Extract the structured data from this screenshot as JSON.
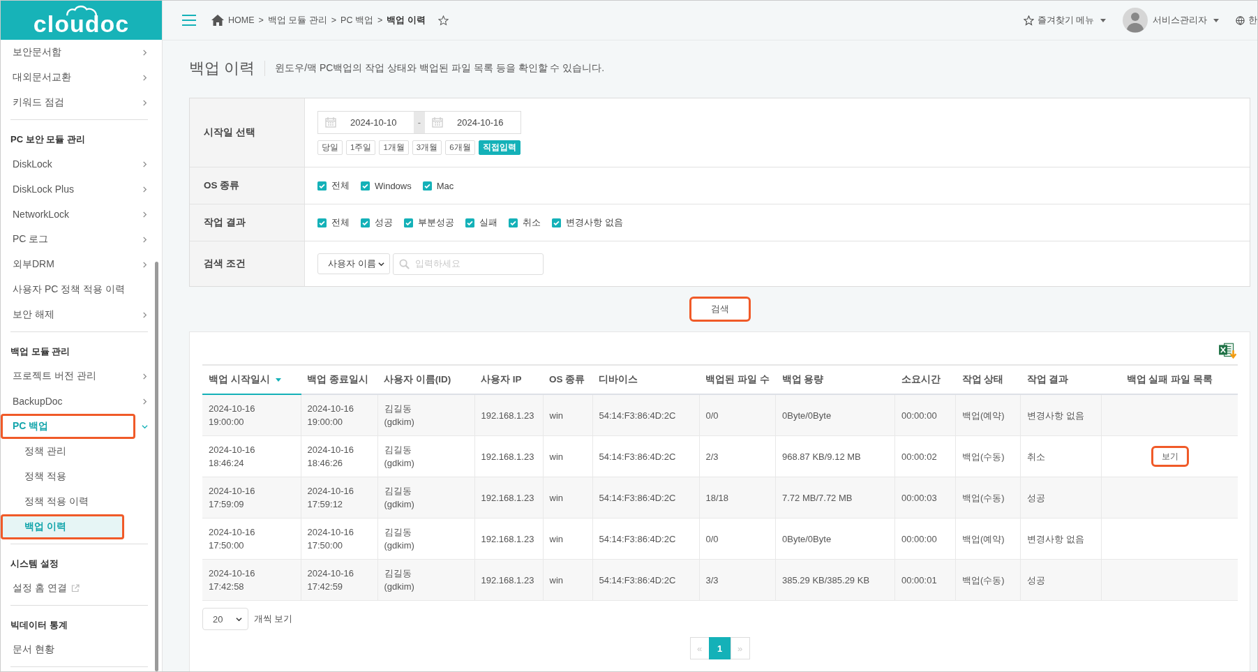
{
  "logo": {
    "text": "cloudoc"
  },
  "header": {
    "breadcrumb": [
      {
        "label": "HOME",
        "current": false
      },
      {
        "label": "백업 모듈 관리",
        "current": false
      },
      {
        "label": "PC 백업",
        "current": false
      },
      {
        "label": "백업 이력",
        "current": true
      }
    ],
    "separator": ">",
    "favorite_menu": "즐겨찾기 메뉴",
    "user_name": "서비스관리자",
    "language": "한"
  },
  "sidebar": {
    "sections": [
      {
        "items": [
          {
            "label": "보안문서함",
            "kind": "group",
            "expanded": false,
            "selected": false,
            "highlighted": false
          },
          {
            "label": "대외문서교환",
            "kind": "group",
            "expanded": false,
            "selected": false,
            "highlighted": false
          },
          {
            "label": "키워드 점검",
            "kind": "group",
            "expanded": false,
            "selected": false,
            "highlighted": false
          }
        ]
      },
      {
        "heading": "PC 보안 모듈 관리",
        "items": [
          {
            "label": "DiskLock",
            "kind": "group",
            "expanded": false,
            "selected": false,
            "highlighted": false
          },
          {
            "label": "DiskLock Plus",
            "kind": "group",
            "expanded": false,
            "selected": false,
            "highlighted": false
          },
          {
            "label": "NetworkLock",
            "kind": "group",
            "expanded": false,
            "selected": false,
            "highlighted": false
          },
          {
            "label": "PC 로그",
            "kind": "group",
            "expanded": false,
            "selected": false,
            "highlighted": false
          },
          {
            "label": "외부DRM",
            "kind": "group",
            "expanded": false,
            "selected": false,
            "highlighted": false
          },
          {
            "label": "사용자 PC 정책 적용 이력",
            "kind": "link",
            "selected": false,
            "highlighted": false
          },
          {
            "label": "보안 해제",
            "kind": "group",
            "expanded": false,
            "selected": false,
            "highlighted": false
          }
        ]
      },
      {
        "heading": "백업 모듈 관리",
        "items": [
          {
            "label": "프로젝트 버전 관리",
            "kind": "group",
            "expanded": false,
            "selected": false,
            "highlighted": false
          },
          {
            "label": "BackupDoc",
            "kind": "group",
            "expanded": false,
            "selected": false,
            "highlighted": false
          },
          {
            "label": "PC 백업",
            "kind": "group",
            "expanded": true,
            "selected": false,
            "highlighted": true,
            "children": [
              {
                "label": "정책 관리",
                "selected": false,
                "highlighted": false
              },
              {
                "label": "정책 적용",
                "selected": false,
                "highlighted": false
              },
              {
                "label": "정책 적용 이력",
                "selected": false,
                "highlighted": false
              },
              {
                "label": "백업 이력",
                "selected": true,
                "highlighted": true
              }
            ]
          }
        ]
      },
      {
        "heading": "시스템 설정",
        "items": [
          {
            "label": "설정 홈 연결",
            "kind": "external",
            "selected": false,
            "highlighted": false
          }
        ]
      },
      {
        "heading": "빅데이터 통계",
        "items": [
          {
            "label": "문서 현황",
            "kind": "link",
            "selected": false,
            "highlighted": false
          }
        ]
      }
    ]
  },
  "page": {
    "title": "백업 이력",
    "description": "윈도우/맥 PC백업의 작업 상태와 백업된 파일 목록 등을 확인할 수 있습니다."
  },
  "filters": [
    {
      "kind": "date",
      "label": "시작일 선택",
      "start": "2024-10-10",
      "separator": "-",
      "end": "2024-10-16",
      "ranges": [
        {
          "label": "당일",
          "selected": false
        },
        {
          "label": "1주일",
          "selected": false
        },
        {
          "label": "1개월",
          "selected": false
        },
        {
          "label": "3개월",
          "selected": false
        },
        {
          "label": "6개월",
          "selected": false
        },
        {
          "label": "직접입력",
          "selected": true
        }
      ]
    },
    {
      "kind": "checkboxes",
      "label": "OS 종류",
      "options": [
        {
          "label": "전체",
          "checked": true
        },
        {
          "label": "Windows",
          "checked": true
        },
        {
          "label": "Mac",
          "checked": true
        }
      ]
    },
    {
      "kind": "checkboxes",
      "label": "작업 결과",
      "options": [
        {
          "label": "전체",
          "checked": true
        },
        {
          "label": "성공",
          "checked": true
        },
        {
          "label": "부분성공",
          "checked": true
        },
        {
          "label": "실패",
          "checked": true
        },
        {
          "label": "취소",
          "checked": true
        },
        {
          "label": "변경사항 없음",
          "checked": true
        }
      ]
    },
    {
      "kind": "search",
      "label": "검색 조건",
      "field": "사용자 이름",
      "placeholder": "입력하세요"
    }
  ],
  "search_button": {
    "label": "검색",
    "highlighted": true
  },
  "table": {
    "columns": [
      {
        "label": "백업 시작일시",
        "sorted": true
      },
      {
        "label": "백업 종료일시",
        "sorted": false
      },
      {
        "label": "사용자 이름(ID)",
        "sorted": false
      },
      {
        "label": "사용자 IP",
        "sorted": false
      },
      {
        "label": "OS 종류",
        "sorted": false
      },
      {
        "label": "디바이스",
        "sorted": false
      },
      {
        "label": "백업된 파일 수",
        "sorted": false
      },
      {
        "label": "백업 용량",
        "sorted": false
      },
      {
        "label": "소요시간",
        "sorted": false
      },
      {
        "label": "작업 상태",
        "sorted": false
      },
      {
        "label": "작업 결과",
        "sorted": false
      },
      {
        "label": "백업 실패 파일 목록",
        "sorted": false
      }
    ],
    "rows": [
      {
        "cells": [
          "2024-10-16\n19:00:00",
          "2024-10-16\n19:00:00",
          "김길동\n(gdkim)",
          "192.168.1.23",
          "win",
          "54:14:F3:86:4D:2C",
          "0/0",
          "0Byte/0Byte",
          "00:00:00",
          "백업(예약)",
          "변경사항 없음"
        ]
      },
      {
        "cells": [
          "2024-10-16\n18:46:24",
          "2024-10-16\n18:46:26",
          "김길동\n(gdkim)",
          "192.168.1.23",
          "win",
          "54:14:F3:86:4D:2C",
          "2/3",
          "968.87 KB/9.12 MB",
          "00:00:02",
          "백업(수동)",
          "취소"
        ],
        "action": {
          "label": "보기",
          "highlighted": true
        }
      },
      {
        "cells": [
          "2024-10-16\n17:59:09",
          "2024-10-16\n17:59:12",
          "김길동\n(gdkim)",
          "192.168.1.23",
          "win",
          "54:14:F3:86:4D:2C",
          "18/18",
          "7.72 MB/7.72 MB",
          "00:00:03",
          "백업(수동)",
          "성공"
        ]
      },
      {
        "cells": [
          "2024-10-16\n17:50:00",
          "2024-10-16\n17:50:00",
          "김길동\n(gdkim)",
          "192.168.1.23",
          "win",
          "54:14:F3:86:4D:2C",
          "0/0",
          "0Byte/0Byte",
          "00:00:00",
          "백업(예약)",
          "변경사항 없음"
        ]
      },
      {
        "cells": [
          "2024-10-16\n17:42:58",
          "2024-10-16\n17:42:59",
          "김길동\n(gdkim)",
          "192.168.1.23",
          "win",
          "54:14:F3:86:4D:2C",
          "3/3",
          "385.29 KB/385.29 KB",
          "00:00:01",
          "백업(수동)",
          "성공"
        ]
      }
    ]
  },
  "page_size": {
    "value": "20",
    "label": "개씩 보기"
  },
  "pagination": {
    "prev": "«",
    "next": "»",
    "pages": [
      {
        "label": "1",
        "selected": true
      }
    ]
  }
}
